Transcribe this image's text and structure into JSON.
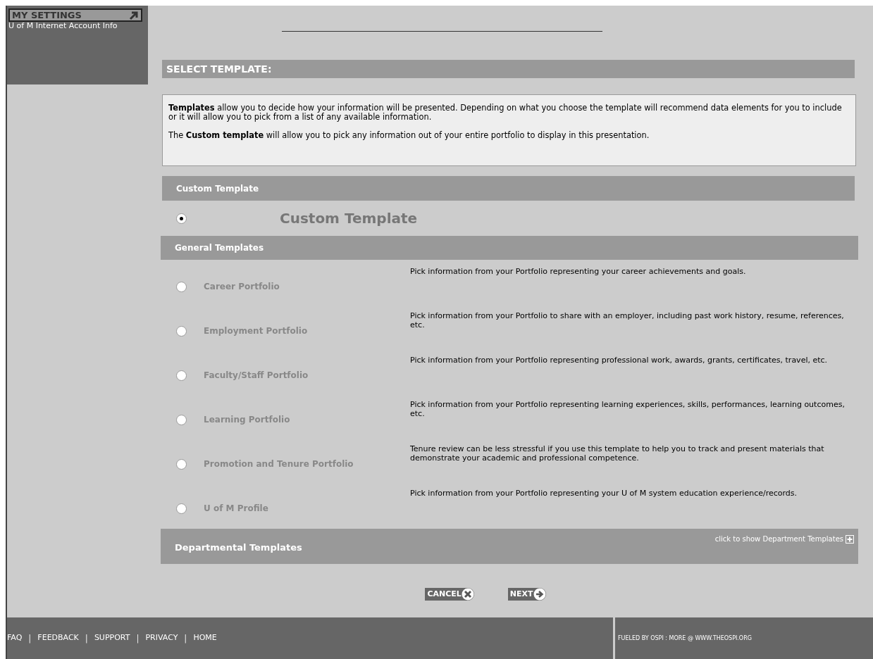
{
  "sidebar": {
    "settings_button": "MY SETTINGS",
    "link": "U of M Internet Account Info"
  },
  "page_title": "SELECT TEMPLATE:",
  "intro": [
    "**Templates** allow you to decide how your information will be presented. Depending on what you choose the template will recommend data elements for you to include or it will allow you to pick from a list of any available information.",
    "The **Custom template** will allow you to pick any information out of your entire portfolio to display in this presentation."
  ],
  "custom_section": {
    "title": "Custom Template",
    "option": {
      "label": "Custom Template",
      "selected": true
    }
  },
  "general_section": {
    "title": "General Templates",
    "options": [
      {
        "label": "Career Portfolio",
        "description": "Pick information from your Portfolio representing your career achievements and goals.",
        "selected": false
      },
      {
        "label": "Employment Portfolio",
        "description": "Pick information from your Portfolio to share with an employer, including past work history, resume, references, etc.",
        "selected": false
      },
      {
        "label": "Faculty/Staff Portfolio",
        "description": "Pick information from your Portfolio representing professional work, awards, grants, certificates, travel, etc.",
        "selected": false
      },
      {
        "label": "Learning Portfolio",
        "description": "Pick information from your Portfolio representing learning experiences, skills, performances, learning outcomes, etc.",
        "selected": false
      },
      {
        "label": "Promotion and Tenure Portfolio",
        "description": "Tenure review can be less stressful if you use this template to help you to track and present materials that demonstrate your academic and professional competence.",
        "selected": false
      },
      {
        "label": "U of M Profile",
        "description": "Pick information from your Portfolio representing your U of M system education experience/records.",
        "selected": false
      }
    ]
  },
  "departmental_section": {
    "title": "Departmental Templates",
    "toggle": "click to show Department Templates"
  },
  "buttons": [
    {
      "kind": "cancel",
      "label": "CANCEL"
    },
    {
      "kind": "next",
      "label": "NEXT"
    }
  ],
  "footer": {
    "items": [
      {
        "kind": "link",
        "text": "FAQ"
      },
      {
        "kind": "separator",
        "text": "|"
      },
      {
        "kind": "link",
        "text": "FEEDBACK"
      },
      {
        "kind": "separator",
        "text": "|"
      },
      {
        "kind": "link",
        "text": "SUPPORT"
      },
      {
        "kind": "separator",
        "text": "|"
      },
      {
        "kind": "link",
        "text": "PRIVACY"
      },
      {
        "kind": "separator",
        "text": "|"
      },
      {
        "kind": "link",
        "text": "HOME"
      }
    ],
    "credit": "FUELED BY OSPI : MORE @ WWW.THEOSPI.ORG"
  }
}
